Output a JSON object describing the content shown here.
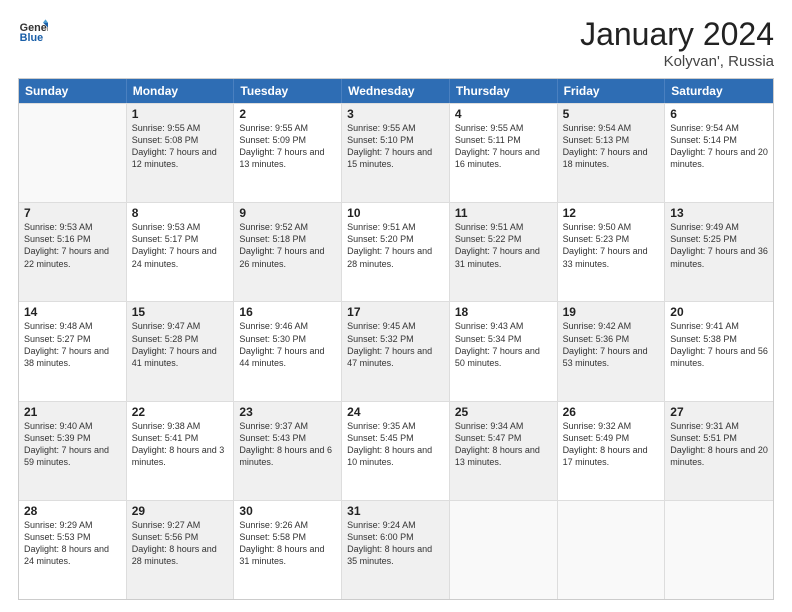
{
  "header": {
    "logo_general": "General",
    "logo_blue": "Blue",
    "month_title": "January 2024",
    "location": "Kolyvan', Russia"
  },
  "days_of_week": [
    "Sunday",
    "Monday",
    "Tuesday",
    "Wednesday",
    "Thursday",
    "Friday",
    "Saturday"
  ],
  "weeks": [
    [
      {
        "day": "",
        "sunrise": "",
        "sunset": "",
        "daylight": "",
        "shaded": false,
        "empty": true
      },
      {
        "day": "1",
        "sunrise": "Sunrise: 9:55 AM",
        "sunset": "Sunset: 5:08 PM",
        "daylight": "Daylight: 7 hours and 12 minutes.",
        "shaded": true,
        "empty": false
      },
      {
        "day": "2",
        "sunrise": "Sunrise: 9:55 AM",
        "sunset": "Sunset: 5:09 PM",
        "daylight": "Daylight: 7 hours and 13 minutes.",
        "shaded": false,
        "empty": false
      },
      {
        "day": "3",
        "sunrise": "Sunrise: 9:55 AM",
        "sunset": "Sunset: 5:10 PM",
        "daylight": "Daylight: 7 hours and 15 minutes.",
        "shaded": true,
        "empty": false
      },
      {
        "day": "4",
        "sunrise": "Sunrise: 9:55 AM",
        "sunset": "Sunset: 5:11 PM",
        "daylight": "Daylight: 7 hours and 16 minutes.",
        "shaded": false,
        "empty": false
      },
      {
        "day": "5",
        "sunrise": "Sunrise: 9:54 AM",
        "sunset": "Sunset: 5:13 PM",
        "daylight": "Daylight: 7 hours and 18 minutes.",
        "shaded": true,
        "empty": false
      },
      {
        "day": "6",
        "sunrise": "Sunrise: 9:54 AM",
        "sunset": "Sunset: 5:14 PM",
        "daylight": "Daylight: 7 hours and 20 minutes.",
        "shaded": false,
        "empty": false
      }
    ],
    [
      {
        "day": "7",
        "sunrise": "Sunrise: 9:53 AM",
        "sunset": "Sunset: 5:16 PM",
        "daylight": "Daylight: 7 hours and 22 minutes.",
        "shaded": true,
        "empty": false
      },
      {
        "day": "8",
        "sunrise": "Sunrise: 9:53 AM",
        "sunset": "Sunset: 5:17 PM",
        "daylight": "Daylight: 7 hours and 24 minutes.",
        "shaded": false,
        "empty": false
      },
      {
        "day": "9",
        "sunrise": "Sunrise: 9:52 AM",
        "sunset": "Sunset: 5:18 PM",
        "daylight": "Daylight: 7 hours and 26 minutes.",
        "shaded": true,
        "empty": false
      },
      {
        "day": "10",
        "sunrise": "Sunrise: 9:51 AM",
        "sunset": "Sunset: 5:20 PM",
        "daylight": "Daylight: 7 hours and 28 minutes.",
        "shaded": false,
        "empty": false
      },
      {
        "day": "11",
        "sunrise": "Sunrise: 9:51 AM",
        "sunset": "Sunset: 5:22 PM",
        "daylight": "Daylight: 7 hours and 31 minutes.",
        "shaded": true,
        "empty": false
      },
      {
        "day": "12",
        "sunrise": "Sunrise: 9:50 AM",
        "sunset": "Sunset: 5:23 PM",
        "daylight": "Daylight: 7 hours and 33 minutes.",
        "shaded": false,
        "empty": false
      },
      {
        "day": "13",
        "sunrise": "Sunrise: 9:49 AM",
        "sunset": "Sunset: 5:25 PM",
        "daylight": "Daylight: 7 hours and 36 minutes.",
        "shaded": true,
        "empty": false
      }
    ],
    [
      {
        "day": "14",
        "sunrise": "Sunrise: 9:48 AM",
        "sunset": "Sunset: 5:27 PM",
        "daylight": "Daylight: 7 hours and 38 minutes.",
        "shaded": false,
        "empty": false
      },
      {
        "day": "15",
        "sunrise": "Sunrise: 9:47 AM",
        "sunset": "Sunset: 5:28 PM",
        "daylight": "Daylight: 7 hours and 41 minutes.",
        "shaded": true,
        "empty": false
      },
      {
        "day": "16",
        "sunrise": "Sunrise: 9:46 AM",
        "sunset": "Sunset: 5:30 PM",
        "daylight": "Daylight: 7 hours and 44 minutes.",
        "shaded": false,
        "empty": false
      },
      {
        "day": "17",
        "sunrise": "Sunrise: 9:45 AM",
        "sunset": "Sunset: 5:32 PM",
        "daylight": "Daylight: 7 hours and 47 minutes.",
        "shaded": true,
        "empty": false
      },
      {
        "day": "18",
        "sunrise": "Sunrise: 9:43 AM",
        "sunset": "Sunset: 5:34 PM",
        "daylight": "Daylight: 7 hours and 50 minutes.",
        "shaded": false,
        "empty": false
      },
      {
        "day": "19",
        "sunrise": "Sunrise: 9:42 AM",
        "sunset": "Sunset: 5:36 PM",
        "daylight": "Daylight: 7 hours and 53 minutes.",
        "shaded": true,
        "empty": false
      },
      {
        "day": "20",
        "sunrise": "Sunrise: 9:41 AM",
        "sunset": "Sunset: 5:38 PM",
        "daylight": "Daylight: 7 hours and 56 minutes.",
        "shaded": false,
        "empty": false
      }
    ],
    [
      {
        "day": "21",
        "sunrise": "Sunrise: 9:40 AM",
        "sunset": "Sunset: 5:39 PM",
        "daylight": "Daylight: 7 hours and 59 minutes.",
        "shaded": true,
        "empty": false
      },
      {
        "day": "22",
        "sunrise": "Sunrise: 9:38 AM",
        "sunset": "Sunset: 5:41 PM",
        "daylight": "Daylight: 8 hours and 3 minutes.",
        "shaded": false,
        "empty": false
      },
      {
        "day": "23",
        "sunrise": "Sunrise: 9:37 AM",
        "sunset": "Sunset: 5:43 PM",
        "daylight": "Daylight: 8 hours and 6 minutes.",
        "shaded": true,
        "empty": false
      },
      {
        "day": "24",
        "sunrise": "Sunrise: 9:35 AM",
        "sunset": "Sunset: 5:45 PM",
        "daylight": "Daylight: 8 hours and 10 minutes.",
        "shaded": false,
        "empty": false
      },
      {
        "day": "25",
        "sunrise": "Sunrise: 9:34 AM",
        "sunset": "Sunset: 5:47 PM",
        "daylight": "Daylight: 8 hours and 13 minutes.",
        "shaded": true,
        "empty": false
      },
      {
        "day": "26",
        "sunrise": "Sunrise: 9:32 AM",
        "sunset": "Sunset: 5:49 PM",
        "daylight": "Daylight: 8 hours and 17 minutes.",
        "shaded": false,
        "empty": false
      },
      {
        "day": "27",
        "sunrise": "Sunrise: 9:31 AM",
        "sunset": "Sunset: 5:51 PM",
        "daylight": "Daylight: 8 hours and 20 minutes.",
        "shaded": true,
        "empty": false
      }
    ],
    [
      {
        "day": "28",
        "sunrise": "Sunrise: 9:29 AM",
        "sunset": "Sunset: 5:53 PM",
        "daylight": "Daylight: 8 hours and 24 minutes.",
        "shaded": false,
        "empty": false
      },
      {
        "day": "29",
        "sunrise": "Sunrise: 9:27 AM",
        "sunset": "Sunset: 5:56 PM",
        "daylight": "Daylight: 8 hours and 28 minutes.",
        "shaded": true,
        "empty": false
      },
      {
        "day": "30",
        "sunrise": "Sunrise: 9:26 AM",
        "sunset": "Sunset: 5:58 PM",
        "daylight": "Daylight: 8 hours and 31 minutes.",
        "shaded": false,
        "empty": false
      },
      {
        "day": "31",
        "sunrise": "Sunrise: 9:24 AM",
        "sunset": "Sunset: 6:00 PM",
        "daylight": "Daylight: 8 hours and 35 minutes.",
        "shaded": true,
        "empty": false
      },
      {
        "day": "",
        "sunrise": "",
        "sunset": "",
        "daylight": "",
        "shaded": false,
        "empty": true
      },
      {
        "day": "",
        "sunrise": "",
        "sunset": "",
        "daylight": "",
        "shaded": false,
        "empty": true
      },
      {
        "day": "",
        "sunrise": "",
        "sunset": "",
        "daylight": "",
        "shaded": false,
        "empty": true
      }
    ]
  ]
}
